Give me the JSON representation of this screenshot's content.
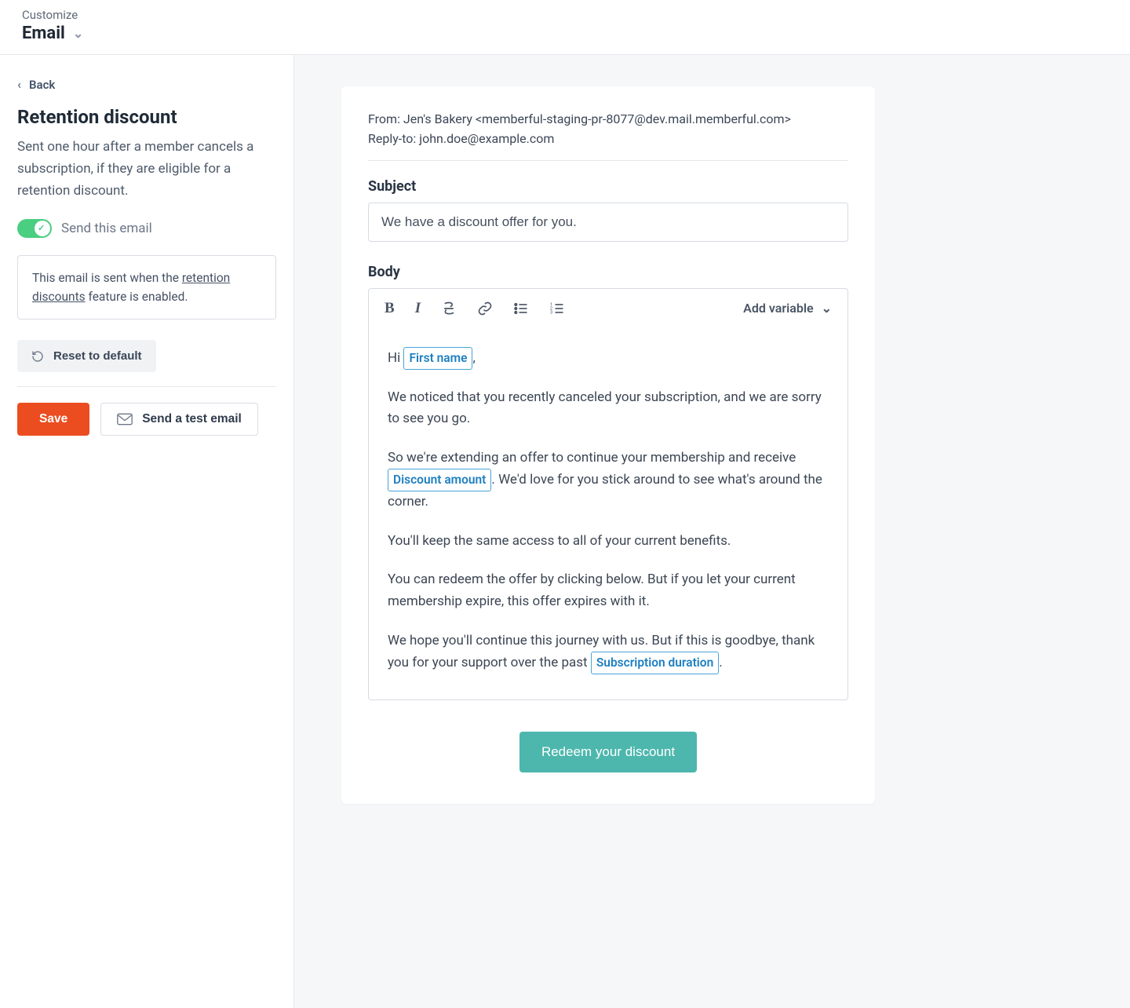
{
  "header": {
    "customize_label": "Customize",
    "channel": "Email"
  },
  "sidebar": {
    "back_label": "Back",
    "title": "Retention discount",
    "description": "Sent one hour after a member cancels a subscription, if they are eligible for a retention discount.",
    "toggle_label": "Send this email",
    "toggle_on": true,
    "info_pre": "This email is sent when the ",
    "info_link": "retention discounts",
    "info_post": " feature is enabled.",
    "reset_label": "Reset to default",
    "save_label": "Save",
    "test_label": "Send a test email"
  },
  "email": {
    "from_label": "From:",
    "from_value": "Jen's Bakery <memberful-staging-pr-8077@dev.mail.memberful.com>",
    "reply_label": "Reply-to:",
    "reply_value": "john.doe@example.com",
    "subject_label": "Subject",
    "subject_value": "We have a discount offer for you.",
    "body_label": "Body",
    "add_variable_label": "Add variable",
    "body": {
      "greeting_pre": "Hi ",
      "greeting_chip": "First name",
      "greeting_post": ",",
      "p1": "We noticed that you recently canceled your subscription, and we are sorry to see you go.",
      "p2_pre": "So we're extending an offer to continue your membership and receive ",
      "p2_chip": "Discount amount",
      "p2_post": ". We'd love for you stick around to see what's around the corner.",
      "p3": "You'll keep the same access to all of your current benefits.",
      "p4": "You can redeem the offer by clicking below. But if you let your current membership expire, this offer expires with it.",
      "p5_pre": "We hope you'll continue this journey with us. But if this is goodbye, thank you for your support over the past ",
      "p5_chip": "Subscription duration",
      "p5_post": "."
    },
    "cta_label": "Redeem your discount"
  }
}
